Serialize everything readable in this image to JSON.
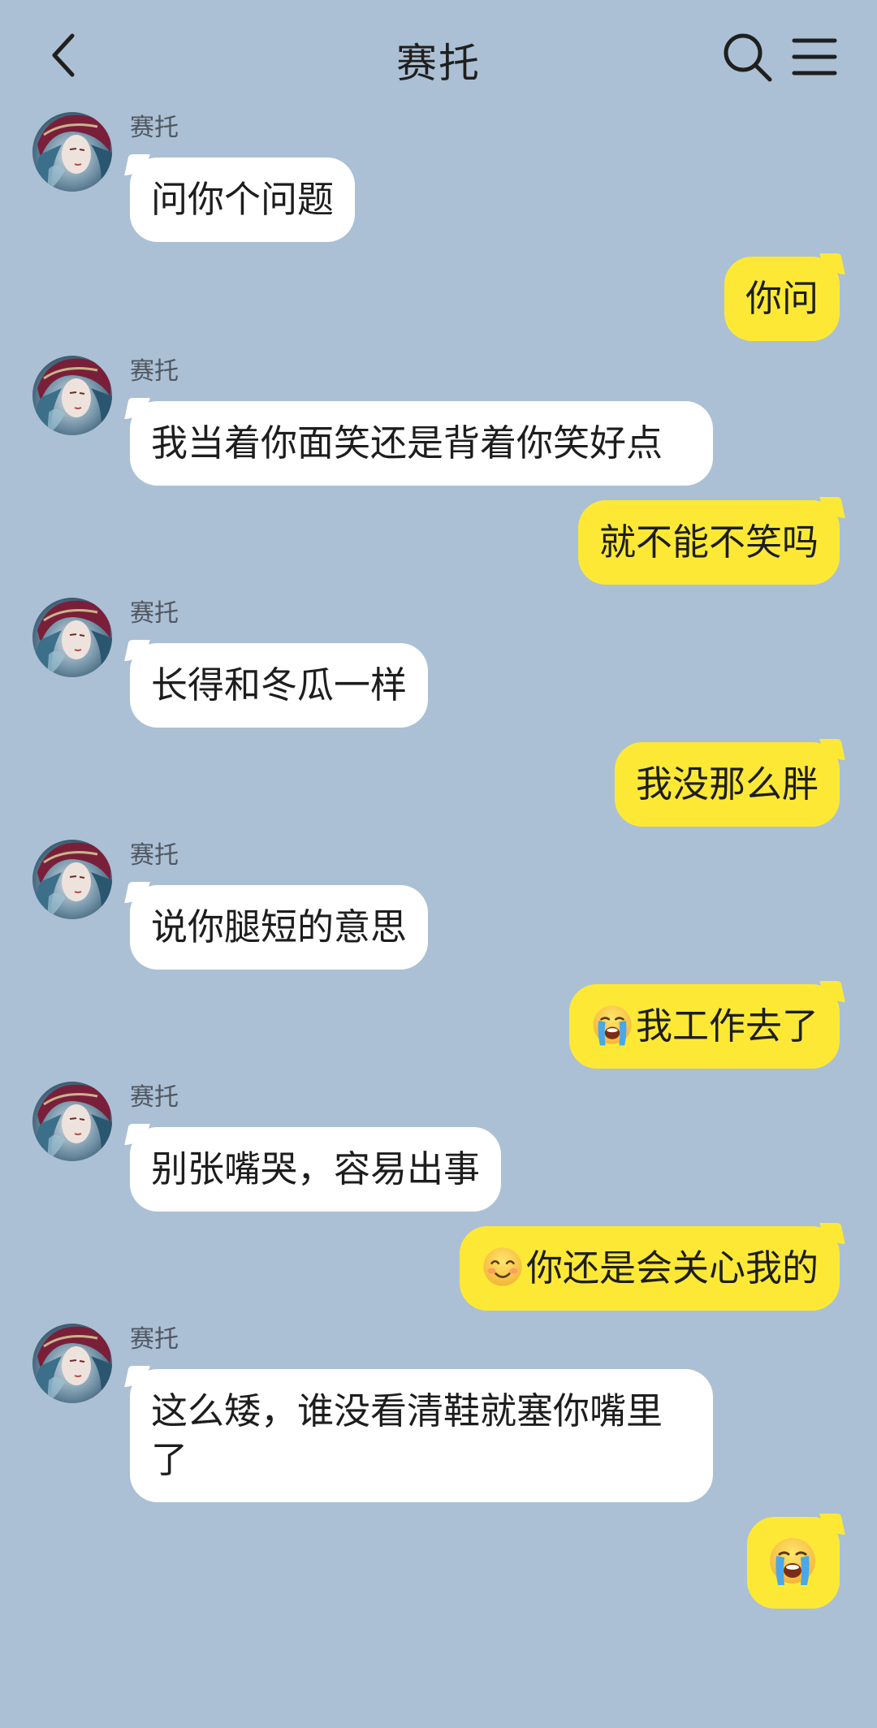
{
  "header": {
    "title": "赛托"
  },
  "icons": {
    "back": "chevron-left-icon",
    "search": "search-icon",
    "menu": "hamburger-menu-icon",
    "crying": "loudly-crying-face-emoji",
    "smiling": "smiling-face-emoji"
  },
  "colors": {
    "background": "#abc0d4",
    "incoming_bubble": "#ffffff",
    "outgoing_bubble": "#fde935"
  },
  "messages": [
    {
      "side": "left",
      "sender": "赛托",
      "text": "问你个问题"
    },
    {
      "side": "right",
      "text": "你问"
    },
    {
      "side": "left",
      "sender": "赛托",
      "text": "我当着你面笑还是背着你笑好点"
    },
    {
      "side": "right",
      "text": "就不能不笑吗"
    },
    {
      "side": "left",
      "sender": "赛托",
      "text": "长得和冬瓜一样"
    },
    {
      "side": "right",
      "text": "我没那么胖"
    },
    {
      "side": "left",
      "sender": "赛托",
      "text": "说你腿短的意思"
    },
    {
      "side": "right",
      "emoji": "loudly-crying-face",
      "text": "我工作去了"
    },
    {
      "side": "left",
      "sender": "赛托",
      "text": "别张嘴哭，容易出事"
    },
    {
      "side": "right",
      "emoji": "smiling-face",
      "text": "你还是会关心我的"
    },
    {
      "side": "left",
      "sender": "赛托",
      "text": "这么矮，谁没看清鞋就塞你嘴里了"
    },
    {
      "side": "right",
      "emoji": "loudly-crying-face",
      "text": ""
    }
  ]
}
